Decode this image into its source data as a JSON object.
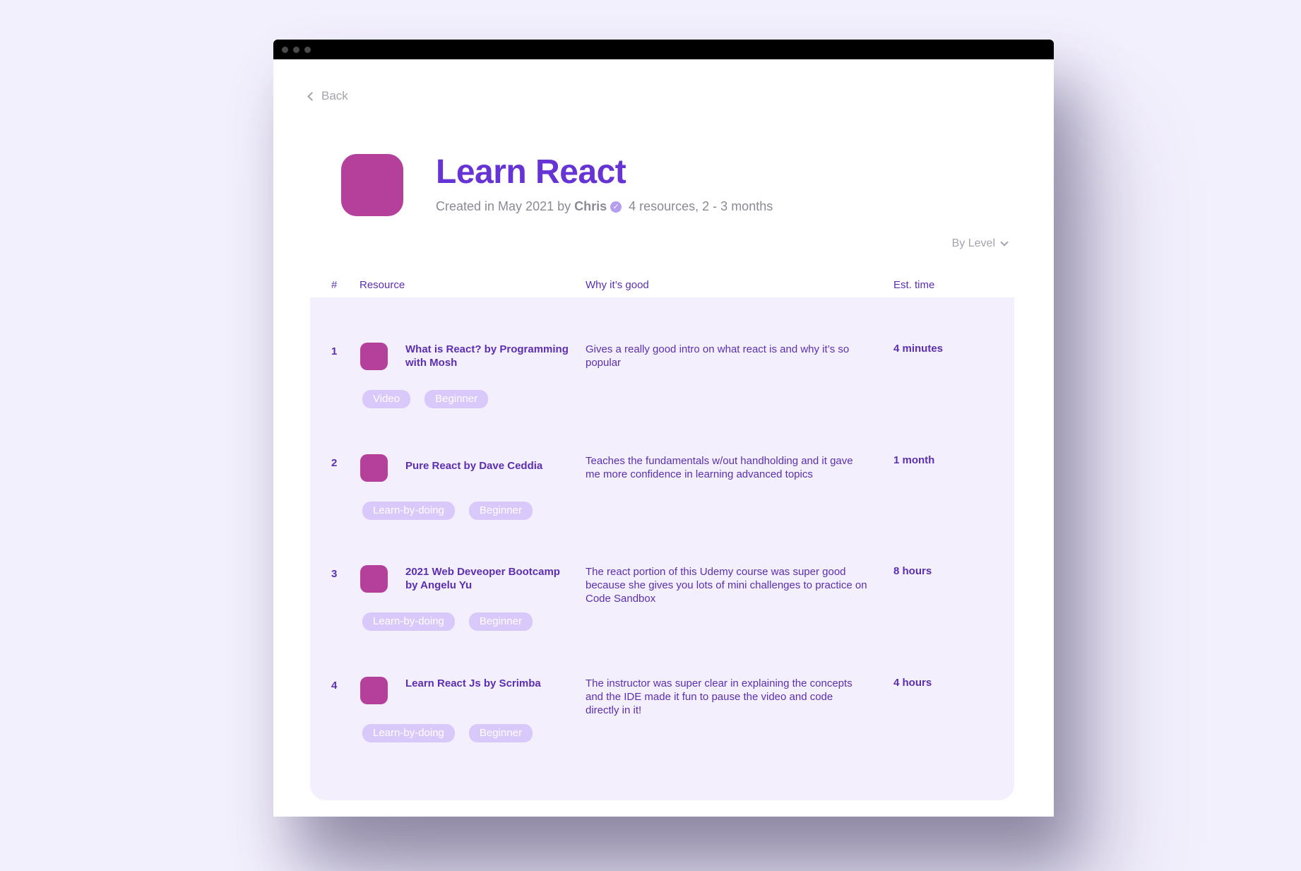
{
  "nav": {
    "back_label": "Back"
  },
  "course": {
    "title": "Learn React",
    "created_prefix": "Created in May 2021 by",
    "author": "Chris",
    "summary": "4 resources, 2 - 3 months",
    "brand_color": "#6633d4",
    "icon_color": "#b5409b"
  },
  "sort": {
    "label": "By Level"
  },
  "table": {
    "headers": {
      "num": "#",
      "resource": "Resource",
      "why": "Why it’s good",
      "time": "Est. time"
    },
    "rows": [
      {
        "num": "1",
        "name": "What is React? by Programming with Mosh",
        "why": "Gives a really good intro on what react is and why it’s so popular",
        "time": "4 minutes",
        "tags": [
          "Video",
          "Beginner"
        ]
      },
      {
        "num": "2",
        "name": "Pure React by Dave Ceddia",
        "why": "Teaches the fundamentals w/out handholding and it gave me more confidence in learning advanced topics",
        "time": "1 month",
        "tags": [
          "Learn-by-doing",
          "Beginner"
        ]
      },
      {
        "num": "3",
        "name": "2021 Web Deveoper Bootcamp by Angelu Yu",
        "why": "The react portion of this Udemy course was super good because she gives you lots of mini challenges to practice on Code Sandbox",
        "time": "8 hours",
        "tags": [
          "Learn-by-doing",
          "Beginner"
        ]
      },
      {
        "num": "4",
        "name": "Learn React Js by Scrimba",
        "why": "The instructor was super clear in explaining the concepts and the IDE made it fun to pause the video and code directly in it!",
        "time": "4 hours",
        "tags": [
          "Learn-by-doing",
          "Beginner"
        ]
      }
    ]
  }
}
